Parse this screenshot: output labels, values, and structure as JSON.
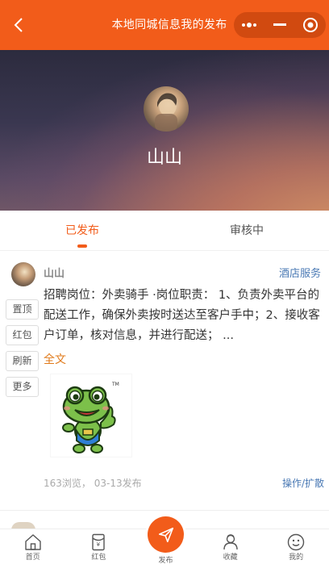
{
  "header": {
    "title": "本地同城信息我的发布",
    "back_icon": "chevron-left-icon",
    "capsule_icons": [
      "more-dots-icon",
      "minimize-icon",
      "close-target-icon"
    ]
  },
  "profile": {
    "name": "山山"
  },
  "tabs": [
    {
      "label": "已发布",
      "active": true
    },
    {
      "label": "审核中",
      "active": false
    }
  ],
  "post": {
    "author": "山山",
    "category": "酒店服务",
    "actions": [
      "置顶",
      "红包",
      "刷新",
      "更多"
    ],
    "content": "招聘岗位：外卖骑手 ·岗位职责： 1、负责外卖平台的配送工作，确保外卖按时送达至客户手中；2、接收客户订单，核对信息，并进行配送； ...",
    "fulltext_label": "全文",
    "stats": "163浏览， 03-13发布",
    "ops_label": "操作/扩散"
  },
  "bottom_nav": [
    {
      "label": "首页",
      "icon": "home-icon"
    },
    {
      "label": "红包",
      "icon": "red-packet-icon"
    },
    {
      "label": "发布",
      "icon": "paper-plane-icon"
    },
    {
      "label": "收藏",
      "icon": "favorites-icon"
    },
    {
      "label": "我的",
      "icon": "smiley-profile-icon"
    }
  ],
  "colors": {
    "brand": "#f25c1a",
    "link": "#4a79b4",
    "fulltext": "#e07a1a"
  }
}
